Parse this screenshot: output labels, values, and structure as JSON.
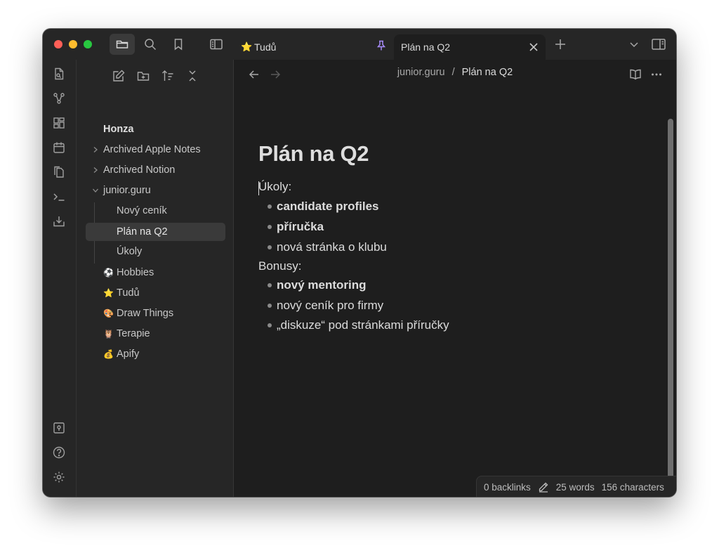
{
  "tabs": [
    {
      "icon": "star-emoji",
      "label": "Tudů"
    },
    {
      "label": "Plán na Q2"
    }
  ],
  "breadcrumb": {
    "folder": "junior.guru",
    "separator": "/",
    "current": "Plán na Q2"
  },
  "sidebar": {
    "vault_name": "Honza",
    "items": [
      {
        "label": "Archived Apple Notes",
        "type": "folder"
      },
      {
        "label": "Archived Notion",
        "type": "folder"
      },
      {
        "label": "junior.guru",
        "type": "folder-open"
      },
      {
        "label": "Nový ceník",
        "type": "file"
      },
      {
        "label": "Plán na Q2",
        "type": "file",
        "selected": true
      },
      {
        "label": "Úkoly",
        "type": "file"
      },
      {
        "label": "Hobbies",
        "emoji": "⚽"
      },
      {
        "label": "Tudů",
        "emoji": "⭐"
      },
      {
        "label": "Draw Things",
        "emoji": "🎨"
      },
      {
        "label": "Terapie",
        "emoji": "🦉"
      },
      {
        "label": "Apify",
        "emoji": "💰"
      }
    ]
  },
  "note": {
    "title": "Plán na Q2",
    "section1": "Úkoly:",
    "tasks": [
      "candidate profiles",
      "příručka",
      "nová stránka o klubu"
    ],
    "section2": "Bonusy:",
    "bonuses": [
      "nový mentoring",
      "nový ceník pro firmy",
      "„diskuze“ pod stránkami příručky"
    ]
  },
  "status": {
    "backlinks": "0 backlinks",
    "words": "25 words",
    "characters": "156 characters"
  },
  "colors": {
    "window_bg": "#1e1e1e",
    "panel_bg": "#262626",
    "pin_accent": "#a78bfa",
    "text": "#dcdcdc"
  }
}
